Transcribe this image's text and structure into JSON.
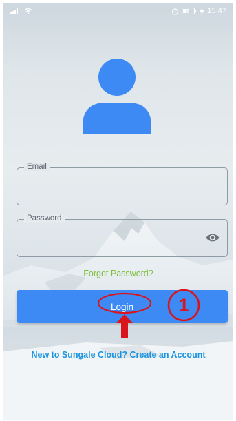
{
  "status_bar": {
    "time": "15:47",
    "battery_level": "56"
  },
  "form": {
    "email_label": "Email",
    "email_value": "",
    "password_label": "Password",
    "password_value": ""
  },
  "links": {
    "forgot_password": "Forgot Password?",
    "create_account": "New to Sungale Cloud? Create an Account"
  },
  "buttons": {
    "login": "Login"
  },
  "annotation": {
    "step_number": "1",
    "color": "#d9141c"
  },
  "colors": {
    "primary": "#3d8af4",
    "forgot_link": "#7cbf3a",
    "create_link": "#1b94e0"
  },
  "icons": {
    "avatar": "person-icon",
    "password_toggle": "eye-icon",
    "signal": "signal-icon",
    "wifi": "wifi-icon",
    "alarm": "alarm-icon",
    "battery": "battery-icon"
  }
}
